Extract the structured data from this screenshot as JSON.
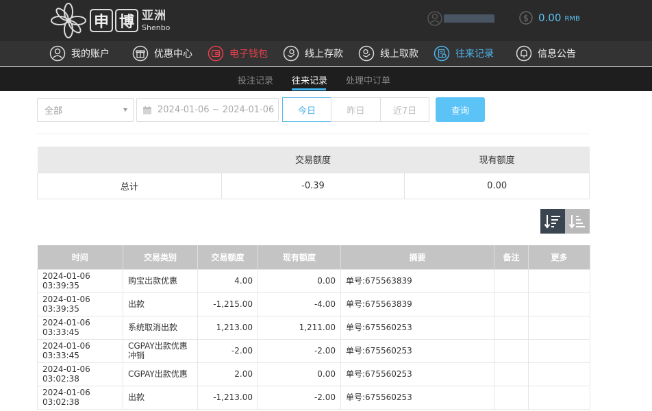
{
  "header": {
    "logo_box_1": "申",
    "logo_box_2": "博",
    "logo_cn": "亚洲",
    "logo_en": "Shenbo",
    "balance_amount": "0.00",
    "balance_currency": "RMB"
  },
  "nav": {
    "items": [
      {
        "label": "我的账户",
        "icon": "user-icon"
      },
      {
        "label": "优惠中心",
        "icon": "gift-icon"
      },
      {
        "label": "电子钱包",
        "icon": "wallet-icon"
      },
      {
        "label": "线上存款",
        "icon": "deposit-icon"
      },
      {
        "label": "线上取款",
        "icon": "withdraw-icon"
      },
      {
        "label": "往来记录",
        "icon": "records-icon"
      },
      {
        "label": "信息公告",
        "icon": "bell-icon"
      }
    ]
  },
  "subnav": {
    "items": [
      "投注记录",
      "往来记录",
      "处理中订单"
    ],
    "active": "往来记录"
  },
  "filters": {
    "type_value": "全部",
    "date_range": "2024-01-06 ~ 2024-01-06",
    "quick": [
      "今日",
      "昨日",
      "近7日"
    ],
    "search_label": "查询"
  },
  "summary": {
    "headers": [
      "",
      "交易额度",
      "现有额度"
    ],
    "label": "总计",
    "amount": "-0.39",
    "balance": "0.00"
  },
  "records": {
    "headers": [
      "时间",
      "交易类别",
      "交易额度",
      "现有额度",
      "摘要",
      "备注",
      "更多"
    ],
    "rows": [
      {
        "time": "2024-01-06 03:39:35",
        "type": "购宝出款优惠",
        "amount": "4.00",
        "balance": "0.00",
        "summary": "单号:675563839",
        "note": "",
        "more": ""
      },
      {
        "time": "2024-01-06 03:39:35",
        "type": "出款",
        "amount": "-1,215.00",
        "balance": "-4.00",
        "summary": "单号:675563839",
        "note": "",
        "more": ""
      },
      {
        "time": "2024-01-06 03:33:45",
        "type": "系统取消出款",
        "amount": "1,213.00",
        "balance": "1,211.00",
        "summary": "单号:675560253",
        "note": "",
        "more": ""
      },
      {
        "time": "2024-01-06 03:33:45",
        "type": "CGPAY出款优惠冲销",
        "amount": "-2.00",
        "balance": "-2.00",
        "summary": "单号:675560253",
        "note": "",
        "more": ""
      },
      {
        "time": "2024-01-06 03:02:38",
        "type": "CGPAY出款优惠",
        "amount": "2.00",
        "balance": "0.00",
        "summary": "单号:675560253",
        "note": "",
        "more": ""
      },
      {
        "time": "2024-01-06 03:02:38",
        "type": "出款",
        "amount": "-1,213.00",
        "balance": "-2.00",
        "summary": "单号:675560253",
        "note": "",
        "more": ""
      }
    ]
  }
}
